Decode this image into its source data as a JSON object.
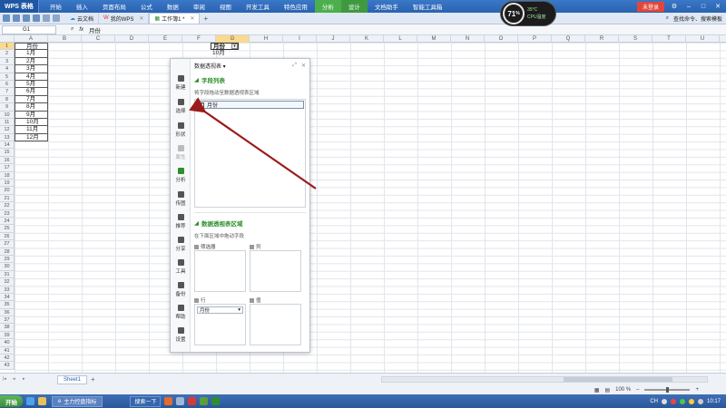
{
  "app": {
    "menu_label": "WPS 表格"
  },
  "ribbon": {
    "tabs": [
      "开始",
      "插入",
      "页面布局",
      "公式",
      "数据",
      "审阅",
      "视图",
      "开发工具",
      "特色应用",
      "分析",
      "设计",
      "文档助手",
      "智能工具箱"
    ],
    "login_label": "未登录"
  },
  "cpu_widget": {
    "percent": "71",
    "unit": "%",
    "temp": "35°C",
    "label": "CPU温度"
  },
  "doc_tabs": [
    {
      "label": "云文档"
    },
    {
      "label": "我的WPS"
    },
    {
      "label": "工作簿1 *"
    }
  ],
  "search": {
    "placeholder": "查找命令、搜索模板"
  },
  "formula_bar": {
    "cell_ref": "G1",
    "fx": "fx",
    "content": "月份"
  },
  "columns": [
    "A",
    "B",
    "C",
    "D",
    "E",
    "F",
    "G",
    "H",
    "I",
    "J",
    "K",
    "L",
    "M",
    "N",
    "O",
    "P",
    "Q",
    "R",
    "S",
    "T",
    "U",
    "V"
  ],
  "column_a": [
    "月份",
    "1月",
    "2月",
    "3月",
    "4月",
    "5月",
    "6月",
    "7月",
    "8月",
    "9月",
    "10月",
    "11月",
    "12月"
  ],
  "column_g": [
    "月份",
    "10月"
  ],
  "row_count": 43,
  "pivot_panel": {
    "title": "数据透视表",
    "side_items": [
      "新建",
      "选择",
      "形状",
      "属性",
      "分析",
      "传图",
      "推荐",
      "分享",
      "工具",
      "备份",
      "帮助",
      "设置"
    ],
    "field_section_title": "字段列表",
    "field_hint": "将字段拖动至数据透视表区域",
    "fields": [
      {
        "label": "月份",
        "checked": true
      }
    ],
    "area_section_title": "数据透视表区域",
    "area_hint": "在下面区域中拖动字段",
    "areas": {
      "filter": "筛选器",
      "column": "列",
      "row": "行",
      "value": "值"
    },
    "row_field": "月份"
  },
  "sheet_tabs": [
    "Sheet1"
  ],
  "status_bar": {
    "zoom": "100 %"
  },
  "taskbar": {
    "start": "开始",
    "task_label": "主力控盘指标",
    "search_btn": "搜索一下",
    "ime": "CH",
    "time": "10:17"
  },
  "colors": {
    "accent_green": "#2d8f2d",
    "arrow": "#9b1b1b",
    "title_blue": "#2a62b0"
  }
}
